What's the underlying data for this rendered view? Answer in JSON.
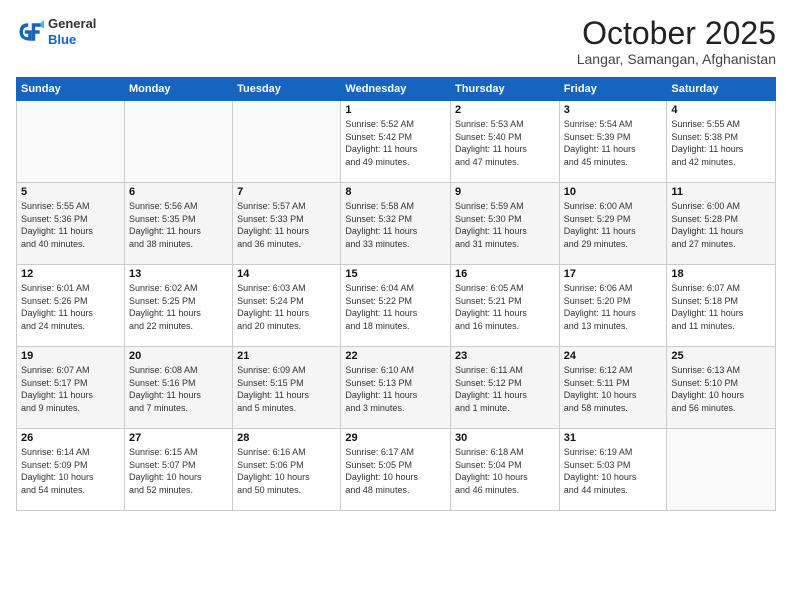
{
  "logo": {
    "general": "General",
    "blue": "Blue"
  },
  "header": {
    "month": "October 2025",
    "location": "Langar, Samangan, Afghanistan"
  },
  "weekdays": [
    "Sunday",
    "Monday",
    "Tuesday",
    "Wednesday",
    "Thursday",
    "Friday",
    "Saturday"
  ],
  "weeks": [
    [
      {
        "num": "",
        "info": ""
      },
      {
        "num": "",
        "info": ""
      },
      {
        "num": "",
        "info": ""
      },
      {
        "num": "1",
        "info": "Sunrise: 5:52 AM\nSunset: 5:42 PM\nDaylight: 11 hours\nand 49 minutes."
      },
      {
        "num": "2",
        "info": "Sunrise: 5:53 AM\nSunset: 5:40 PM\nDaylight: 11 hours\nand 47 minutes."
      },
      {
        "num": "3",
        "info": "Sunrise: 5:54 AM\nSunset: 5:39 PM\nDaylight: 11 hours\nand 45 minutes."
      },
      {
        "num": "4",
        "info": "Sunrise: 5:55 AM\nSunset: 5:38 PM\nDaylight: 11 hours\nand 42 minutes."
      }
    ],
    [
      {
        "num": "5",
        "info": "Sunrise: 5:55 AM\nSunset: 5:36 PM\nDaylight: 11 hours\nand 40 minutes."
      },
      {
        "num": "6",
        "info": "Sunrise: 5:56 AM\nSunset: 5:35 PM\nDaylight: 11 hours\nand 38 minutes."
      },
      {
        "num": "7",
        "info": "Sunrise: 5:57 AM\nSunset: 5:33 PM\nDaylight: 11 hours\nand 36 minutes."
      },
      {
        "num": "8",
        "info": "Sunrise: 5:58 AM\nSunset: 5:32 PM\nDaylight: 11 hours\nand 33 minutes."
      },
      {
        "num": "9",
        "info": "Sunrise: 5:59 AM\nSunset: 5:30 PM\nDaylight: 11 hours\nand 31 minutes."
      },
      {
        "num": "10",
        "info": "Sunrise: 6:00 AM\nSunset: 5:29 PM\nDaylight: 11 hours\nand 29 minutes."
      },
      {
        "num": "11",
        "info": "Sunrise: 6:00 AM\nSunset: 5:28 PM\nDaylight: 11 hours\nand 27 minutes."
      }
    ],
    [
      {
        "num": "12",
        "info": "Sunrise: 6:01 AM\nSunset: 5:26 PM\nDaylight: 11 hours\nand 24 minutes."
      },
      {
        "num": "13",
        "info": "Sunrise: 6:02 AM\nSunset: 5:25 PM\nDaylight: 11 hours\nand 22 minutes."
      },
      {
        "num": "14",
        "info": "Sunrise: 6:03 AM\nSunset: 5:24 PM\nDaylight: 11 hours\nand 20 minutes."
      },
      {
        "num": "15",
        "info": "Sunrise: 6:04 AM\nSunset: 5:22 PM\nDaylight: 11 hours\nand 18 minutes."
      },
      {
        "num": "16",
        "info": "Sunrise: 6:05 AM\nSunset: 5:21 PM\nDaylight: 11 hours\nand 16 minutes."
      },
      {
        "num": "17",
        "info": "Sunrise: 6:06 AM\nSunset: 5:20 PM\nDaylight: 11 hours\nand 13 minutes."
      },
      {
        "num": "18",
        "info": "Sunrise: 6:07 AM\nSunset: 5:18 PM\nDaylight: 11 hours\nand 11 minutes."
      }
    ],
    [
      {
        "num": "19",
        "info": "Sunrise: 6:07 AM\nSunset: 5:17 PM\nDaylight: 11 hours\nand 9 minutes."
      },
      {
        "num": "20",
        "info": "Sunrise: 6:08 AM\nSunset: 5:16 PM\nDaylight: 11 hours\nand 7 minutes."
      },
      {
        "num": "21",
        "info": "Sunrise: 6:09 AM\nSunset: 5:15 PM\nDaylight: 11 hours\nand 5 minutes."
      },
      {
        "num": "22",
        "info": "Sunrise: 6:10 AM\nSunset: 5:13 PM\nDaylight: 11 hours\nand 3 minutes."
      },
      {
        "num": "23",
        "info": "Sunrise: 6:11 AM\nSunset: 5:12 PM\nDaylight: 11 hours\nand 1 minute."
      },
      {
        "num": "24",
        "info": "Sunrise: 6:12 AM\nSunset: 5:11 PM\nDaylight: 10 hours\nand 58 minutes."
      },
      {
        "num": "25",
        "info": "Sunrise: 6:13 AM\nSunset: 5:10 PM\nDaylight: 10 hours\nand 56 minutes."
      }
    ],
    [
      {
        "num": "26",
        "info": "Sunrise: 6:14 AM\nSunset: 5:09 PM\nDaylight: 10 hours\nand 54 minutes."
      },
      {
        "num": "27",
        "info": "Sunrise: 6:15 AM\nSunset: 5:07 PM\nDaylight: 10 hours\nand 52 minutes."
      },
      {
        "num": "28",
        "info": "Sunrise: 6:16 AM\nSunset: 5:06 PM\nDaylight: 10 hours\nand 50 minutes."
      },
      {
        "num": "29",
        "info": "Sunrise: 6:17 AM\nSunset: 5:05 PM\nDaylight: 10 hours\nand 48 minutes."
      },
      {
        "num": "30",
        "info": "Sunrise: 6:18 AM\nSunset: 5:04 PM\nDaylight: 10 hours\nand 46 minutes."
      },
      {
        "num": "31",
        "info": "Sunrise: 6:19 AM\nSunset: 5:03 PM\nDaylight: 10 hours\nand 44 minutes."
      },
      {
        "num": "",
        "info": ""
      }
    ]
  ]
}
